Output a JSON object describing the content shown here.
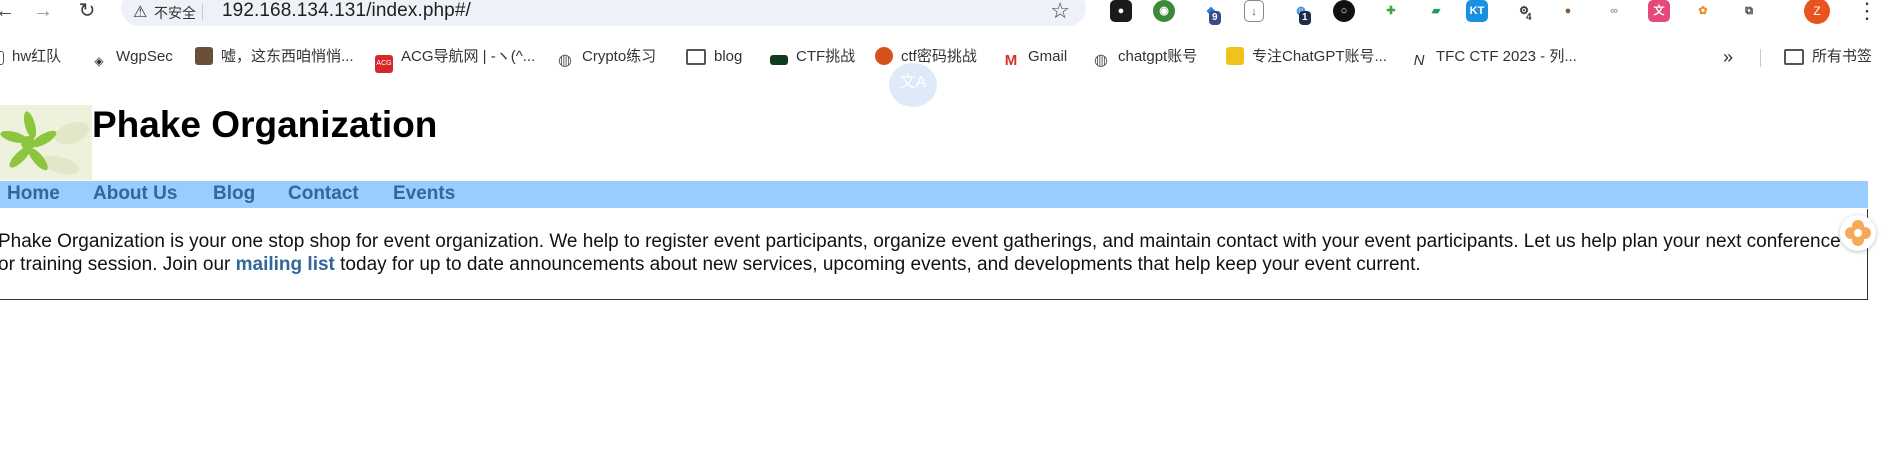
{
  "browser": {
    "security_label": "不安全",
    "url": "192.168.134.131/index.php#/",
    "extensions": [
      {
        "name": "ext-1",
        "badge": ""
      },
      {
        "name": "ext-2",
        "badge": ""
      },
      {
        "name": "ext-3",
        "badge": "9"
      },
      {
        "name": "ext-4",
        "badge": ""
      },
      {
        "name": "ext-5",
        "badge": "1"
      },
      {
        "name": "ext-6",
        "badge": ""
      },
      {
        "name": "ext-7",
        "badge": ""
      },
      {
        "name": "ext-8",
        "badge": ""
      },
      {
        "name": "ext-9",
        "badge": ""
      },
      {
        "name": "ext-10",
        "badge": "4"
      }
    ],
    "profile_initial": "Z",
    "kt_label": "KT"
  },
  "bookmarks": [
    "hw红队",
    "WgpSec",
    "嘘，这东西咱悄悄...",
    "ACG导航网 | -ヽ(^...",
    "Crypto练习",
    "blog",
    "CTF挑战",
    "ctf密码挑战",
    "Gmail",
    "chatgpt账号",
    "专注ChatGPT账号...",
    "TFC CTF 2023 - 列..."
  ],
  "bookmarks_more": "»",
  "all_bookmarks": "所有书签",
  "translate_label": "文A",
  "page": {
    "title": "Phake Organization",
    "menu": [
      "Home",
      "About Us",
      "Blog",
      "Contact",
      "Events"
    ],
    "intro_1": "Phake Organization is your one stop shop for event organization. We help to register event participants, organize event gatherings, and maintain contact with your event participants. Let us help plan your next conference or training session. Join our ",
    "intro_link": "mailing list",
    "intro_2": " today for up to date announcements about new services, upcoming events, and developments that help keep your event current."
  }
}
